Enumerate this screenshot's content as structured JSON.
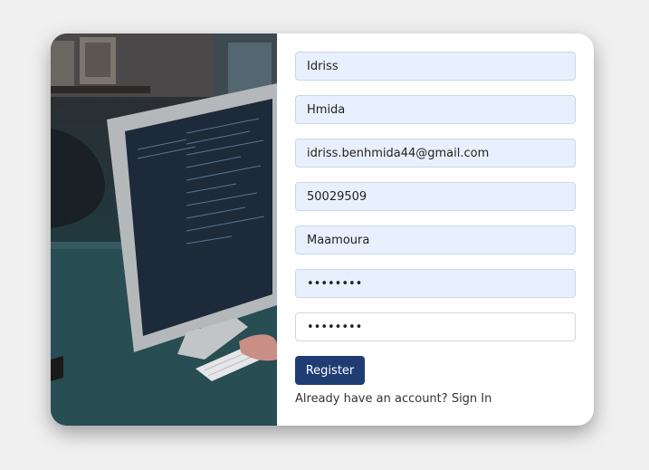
{
  "form": {
    "first_name": "Idriss",
    "last_name": "Hmida",
    "email": "idriss.benhmida44@gmail.com",
    "phone": "50029509",
    "city": "Maamoura",
    "password": "12345678",
    "confirm_password": "12345678",
    "register_label": "Register",
    "login_prompt": "Already have an account?",
    "login_link": "Sign In"
  }
}
